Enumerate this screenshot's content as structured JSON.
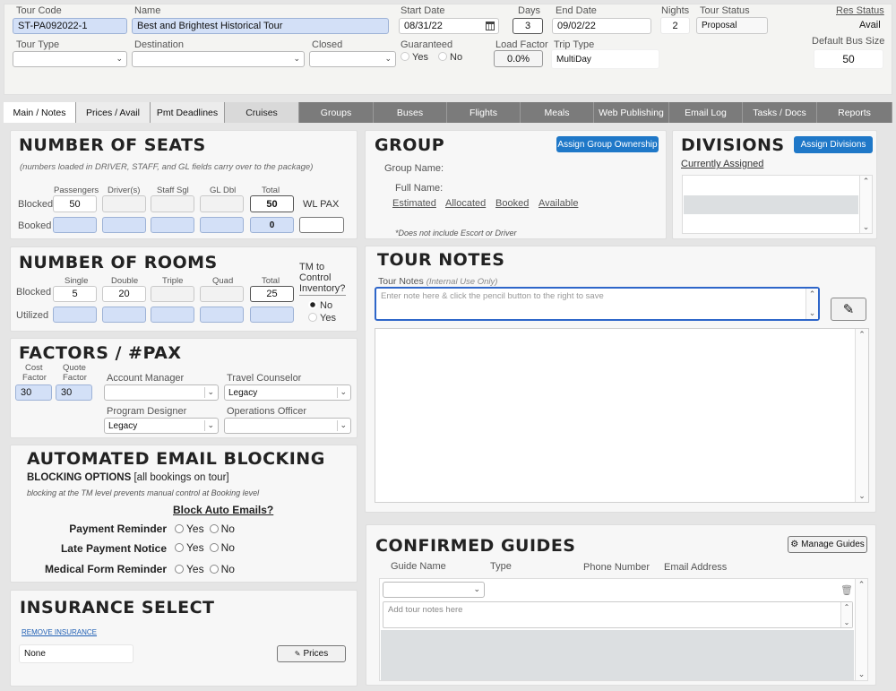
{
  "header": {
    "tour_code_label": "Tour Code",
    "tour_code": "ST-PA092022-1",
    "name_label": "Name",
    "name": "Best and Brightest Historical Tour",
    "start_date_label": "Start Date",
    "start_date": "08/31/22",
    "days_label": "Days",
    "days": "3",
    "end_date_label": "End Date",
    "end_date": "09/02/22",
    "nights_label": "Nights",
    "nights": "2",
    "tour_status_label": "Tour Status",
    "tour_status": "Proposal",
    "res_status_label": "Res Status",
    "res_status": "Avail",
    "tour_type_label": "Tour Type",
    "destination_label": "Destination",
    "closed_label": "Closed",
    "guaranteed_label": "Guaranteed",
    "guaranteed_yes": "Yes",
    "guaranteed_no": "No",
    "load_factor_label": "Load Factor",
    "load_factor": "0.0%",
    "trip_type_label": "Trip Type",
    "trip_type": "MultiDay",
    "default_bus_size_label": "Default Bus Size",
    "default_bus_size": "50"
  },
  "tabs": [
    "Main / Notes",
    "Prices / Avail",
    "Pmt Deadlines",
    "Cruises",
    "Groups",
    "Buses",
    "Flights",
    "Meals",
    "Web Publishing",
    "Email Log",
    "Tasks / Docs",
    "Reports"
  ],
  "seats": {
    "title": "NUMBER OF SEATS",
    "note": "(numbers loaded in DRIVER, STAFF, and GL fields carry over to the package)",
    "cols": [
      "Passengers",
      "Driver(s)",
      "Staff Sgl",
      "GL Dbl",
      "Total"
    ],
    "blocked_label": "Blocked",
    "booked_label": "Booked",
    "blocked_passengers": "50",
    "blocked_total": "50",
    "booked_total": "0",
    "wl_pax_label": "WL PAX"
  },
  "rooms": {
    "title": "NUMBER OF ROOMS",
    "cols": [
      "Single",
      "Double",
      "Triple",
      "Quad",
      "Total"
    ],
    "blocked_label": "Blocked",
    "utilized_label": "Utilized",
    "single": "5",
    "double": "20",
    "total": "25",
    "tm_label_1": "TM to",
    "tm_label_2": "Control",
    "tm_label_3": "Inventory?",
    "tm_no": "No",
    "tm_yes": "Yes"
  },
  "factors": {
    "title": "FACTORS / #PAX",
    "cost_label_1": "Cost",
    "cost_label_2": "Factor",
    "quote_label_1": "Quote",
    "quote_label_2": "Factor",
    "cost_factor": "30",
    "quote_factor": "30",
    "account_manager_label": "Account Manager",
    "travel_counselor_label": "Travel Counselor",
    "travel_counselor": "Legacy",
    "program_designer_label": "Program Designer",
    "program_designer": "Legacy",
    "operations_officer_label": "Operations Officer"
  },
  "email_blocking": {
    "title": "AUTOMATED EMAIL BLOCKING",
    "options_bold": "BLOCKING OPTIONS",
    "options_rest": " [all bookings on tour]",
    "note": "blocking at the TM level prevents manual control at Booking level",
    "block_header": "Block Auto Emails?",
    "rows": [
      "Payment Reminder",
      "Late Payment Notice",
      "Medical Form Reminder"
    ],
    "yes": "Yes",
    "no": "No"
  },
  "insurance": {
    "title": "INSURANCE SELECT",
    "remove_link": "REMOVE INSURANCE",
    "value": "None",
    "prices_button": "Prices"
  },
  "group": {
    "title": "GROUP",
    "assign_button": "Assign Group Ownership",
    "group_name_label": "Group Name:",
    "full_name_label": "Full Name:",
    "links": [
      "Estimated",
      "Allocated",
      "Booked",
      "Available"
    ],
    "note": "*Does not include Escort or Driver"
  },
  "divisions": {
    "title": "DIVISIONS",
    "assign_button": "Assign Divisions",
    "currently_assigned": "Currently Assigned"
  },
  "tour_notes": {
    "title": "TOUR NOTES",
    "label": "Tour Notes",
    "label_hint": "(Internal Use Only)",
    "placeholder": "Enter note here & click the pencil button to the right to save"
  },
  "guides": {
    "title": "CONFIRMED GUIDES",
    "manage_button": "Manage Guides",
    "cols": [
      "Guide Name",
      "Type",
      "Phone Number",
      "Email Address"
    ],
    "notes_placeholder": "Add tour notes here"
  },
  "colors": {
    "accent_blue": "#1f78c8",
    "field_blue": "#d3e0f7",
    "tab_grey": "#7b7b7b"
  }
}
